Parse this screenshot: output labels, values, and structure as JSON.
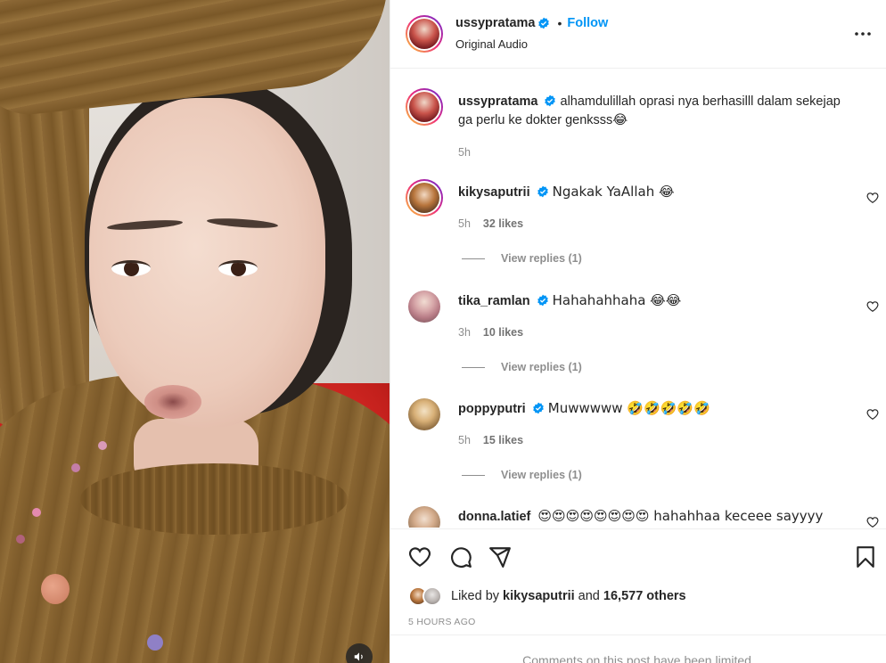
{
  "post": {
    "username": "ussypratama",
    "follow_label": "Follow",
    "separator": "•",
    "audio": "Original Audio",
    "caption_user": "ussypratama",
    "caption": "alhamdulillah oprasi nya berhasilll dalam sekejap ga perlu ke dokter genksss😂",
    "caption_time": "5h"
  },
  "comments": [
    {
      "username": "kikysaputrii",
      "text": "Ngakak YaAllah 😂",
      "time": "5h",
      "likes": "32 likes",
      "replies": "View replies (1)"
    },
    {
      "username": "tika_ramlan",
      "text": "Hahahahhaha 😂😂",
      "time": "3h",
      "likes": "10 likes",
      "replies": "View replies (1)"
    },
    {
      "username": "poppyputri",
      "text": "Muwwwww 🤣🤣🤣🤣🤣",
      "time": "5h",
      "likes": "15 likes",
      "replies": "View replies (1)"
    },
    {
      "username": "donna.latief",
      "text": "😍😍😍😍😍😍😍😍 hahahhaa keceee sayyyy",
      "time": "",
      "likes": "",
      "replies": ""
    }
  ],
  "footer": {
    "liked_prefix": "Liked by",
    "liked_user": "kikysaputrii",
    "liked_and": "and",
    "liked_count": "16,577 others",
    "timestamp": "5 HOURS AGO",
    "limited": "Comments on this post have been limited."
  },
  "colors": {
    "accent": "#0095f6",
    "text": "#262626",
    "muted": "#8e8e8e",
    "verified": "#0095f6"
  },
  "icons": [
    "more-icon",
    "verified-icon",
    "heart-icon",
    "comment-icon",
    "share-icon",
    "bookmark-icon",
    "sound-icon"
  ]
}
